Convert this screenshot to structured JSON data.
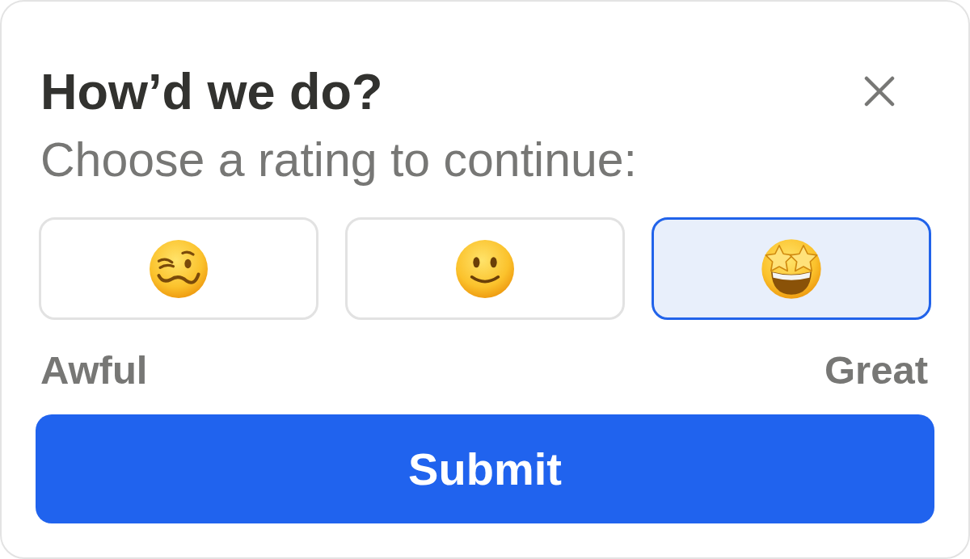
{
  "dialog": {
    "title": "How’d we do?",
    "subtitle": "Choose a rating to continue:"
  },
  "rating_options": [
    {
      "selected": false
    },
    {
      "selected": false
    },
    {
      "selected": true
    }
  ],
  "scale_labels": {
    "low": "Awful",
    "high": "Great"
  },
  "submit_button": "Submit"
}
